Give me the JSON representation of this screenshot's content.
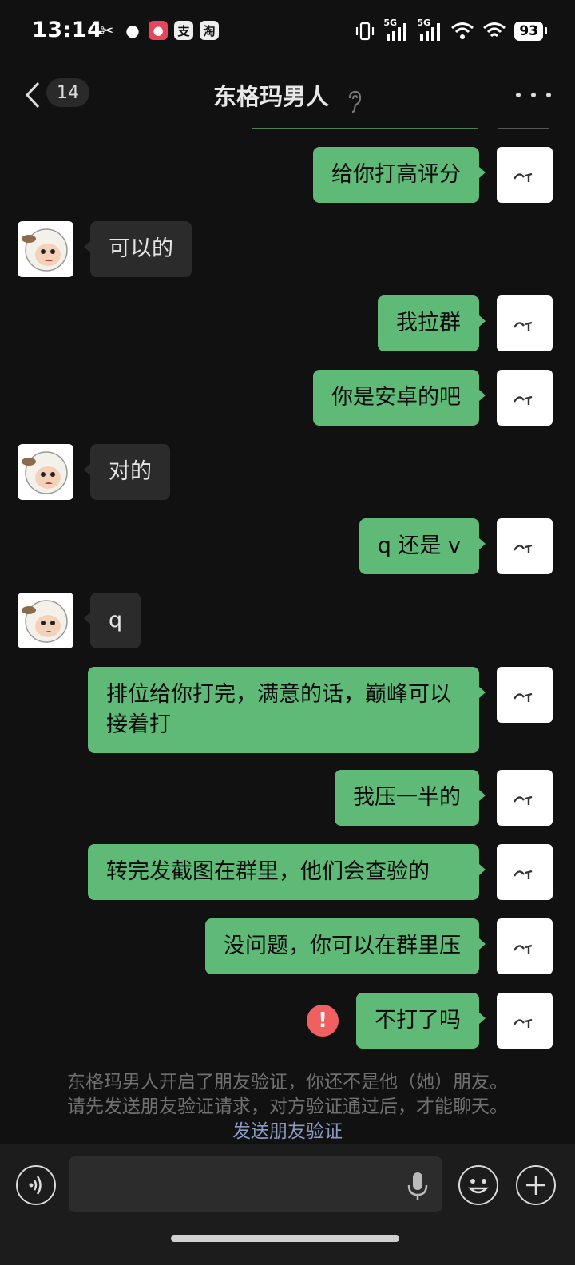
{
  "status_bar": {
    "time": "13:14",
    "left_icons": [
      "capcut-icon",
      "flame-icon",
      "social-app-icon",
      "alipay-icon",
      "taobao-icon"
    ],
    "left_glyphs": [
      "✂",
      "●",
      "●",
      "支",
      "淘"
    ],
    "signal_labels": [
      "5G",
      "5G"
    ],
    "battery": "93"
  },
  "header": {
    "unread_count": "14",
    "title": "东格玛男人"
  },
  "messages": [
    {
      "side": "out",
      "text": "给你打高评分"
    },
    {
      "side": "in",
      "text": "可以的"
    },
    {
      "side": "out",
      "text": "我拉群"
    },
    {
      "side": "out",
      "text": "你是安卓的吧"
    },
    {
      "side": "in",
      "text": "对的"
    },
    {
      "side": "out",
      "text": "q 还是 v"
    },
    {
      "side": "in",
      "text": "q"
    },
    {
      "side": "out",
      "text": "排位给你打完，满意的话，巅峰可以接着打"
    },
    {
      "side": "out",
      "text": "我压一半的"
    },
    {
      "side": "out",
      "text": "转完发截图在群里，他们会查验的"
    },
    {
      "side": "out",
      "text": "没问题，你可以在群里压"
    },
    {
      "side": "out",
      "text": "不打了吗",
      "failed": true
    }
  ],
  "notice": {
    "line1": "东格玛男人开启了朋友验证，你还不是他（她）朋友。",
    "line2": "请先发送朋友验证请求，对方验证通过后，才能聊天。",
    "link": "发送朋友验证"
  },
  "input": {
    "value": "",
    "placeholder": ""
  },
  "colors": {
    "background": "#111111",
    "outgoing_bubble": "#5fb977",
    "incoming_bubble": "#2b2b2b",
    "error": "#f06063",
    "link": "#8a9bc4"
  }
}
